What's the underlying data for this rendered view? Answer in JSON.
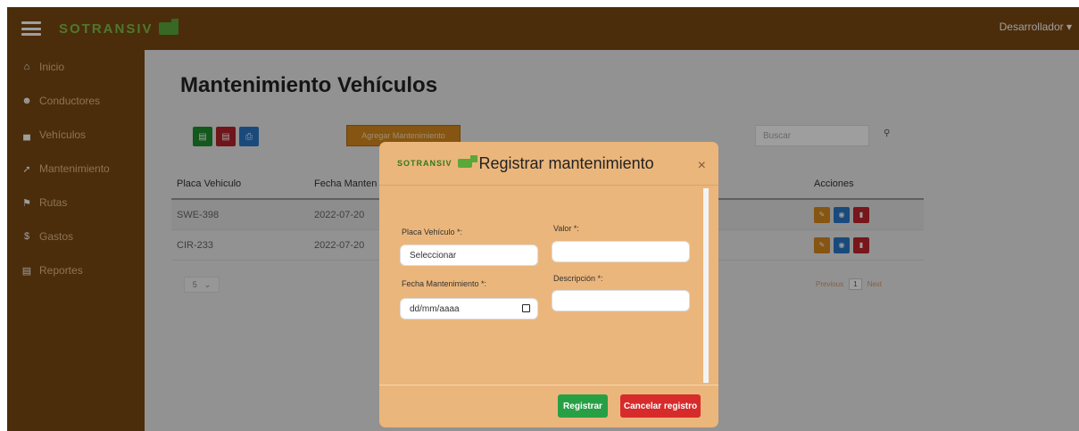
{
  "app": {
    "brand": "SOTRANSIV",
    "user": "Desarrollador ▾"
  },
  "sidebar": {
    "items": [
      {
        "label": "Inicio",
        "icon": "home-icon"
      },
      {
        "label": "Conductores",
        "icon": "users-icon"
      },
      {
        "label": "Vehículos",
        "icon": "car-icon"
      },
      {
        "label": "Mantenimiento",
        "icon": "wrench-icon"
      },
      {
        "label": "Rutas",
        "icon": "route-icon"
      },
      {
        "label": "Gastos",
        "icon": "money-icon"
      },
      {
        "label": "Reportes",
        "icon": "report-icon"
      }
    ]
  },
  "main": {
    "title": "Mantenimiento Vehículos",
    "add_label": "Agregar Mantenimiento",
    "search_placeholder": "Buscar",
    "table": {
      "headers": [
        "Placa Vehiculo",
        "Fecha Manten",
        "Acciones"
      ],
      "rows": [
        {
          "placa": "SWE-398",
          "fecha": "2022-07-20"
        },
        {
          "placa": "CIR-233",
          "fecha": "2022-07-20"
        }
      ]
    },
    "page_size": "5",
    "pager": {
      "previous": "Previous",
      "current": "1",
      "next": "Next"
    }
  },
  "modal": {
    "brand": "SOTRANSIV",
    "title": "Registrar mantenimiento",
    "close": "×",
    "placa_label": "Placa Vehículo *:",
    "placa_value": "Seleccionar",
    "fecha_label": "Fecha Mantenimiento *:",
    "fecha_placeholder": "dd/mm/aaaa",
    "valor_label": "Valor *:",
    "descripcion_label": "Descripción *:",
    "register_label": "Registrar",
    "cancel_label": "Cancelar registro"
  },
  "colors": {
    "topbar": "#7a4a12",
    "modal": "#ebb67b",
    "green": "#27a045",
    "red": "#d72b2b",
    "blue": "#2a78c8",
    "orange": "#d98a1c"
  }
}
